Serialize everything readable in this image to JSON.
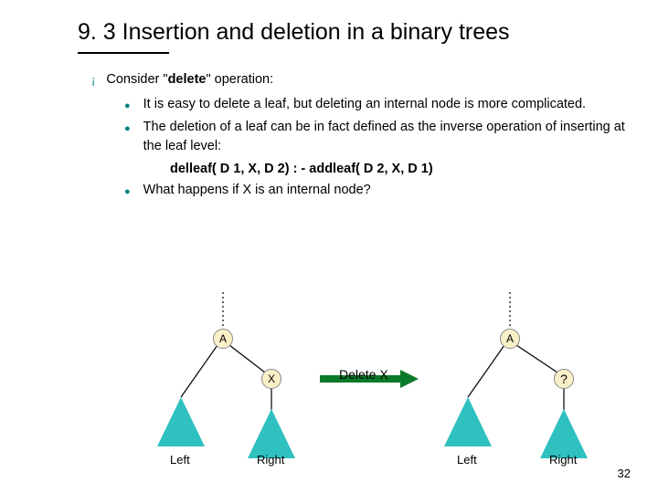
{
  "title": "9. 3 Insertion and deletion in a binary trees",
  "intro_pre": "Consider \"",
  "intro_bold": "delete",
  "intro_post": "\" operation:",
  "items": [
    "It is easy to delete a leaf, but deleting an internal node is more complicated.",
    "The deletion of a leaf can be in fact defined as the inverse operation of inserting at the leaf level:",
    "What happens if X is an internal node?"
  ],
  "code_line": "delleaf( D 1, X, D 2) : - addleaf( D 2, X, D 1)",
  "diagram": {
    "nodeA1": "A",
    "nodeX": "X",
    "nodeA2": "A",
    "nodeQ": "?",
    "leftLabel": "Left",
    "rightLabel": "Right",
    "deleteLabel": "Delete X"
  },
  "page_number": "32"
}
